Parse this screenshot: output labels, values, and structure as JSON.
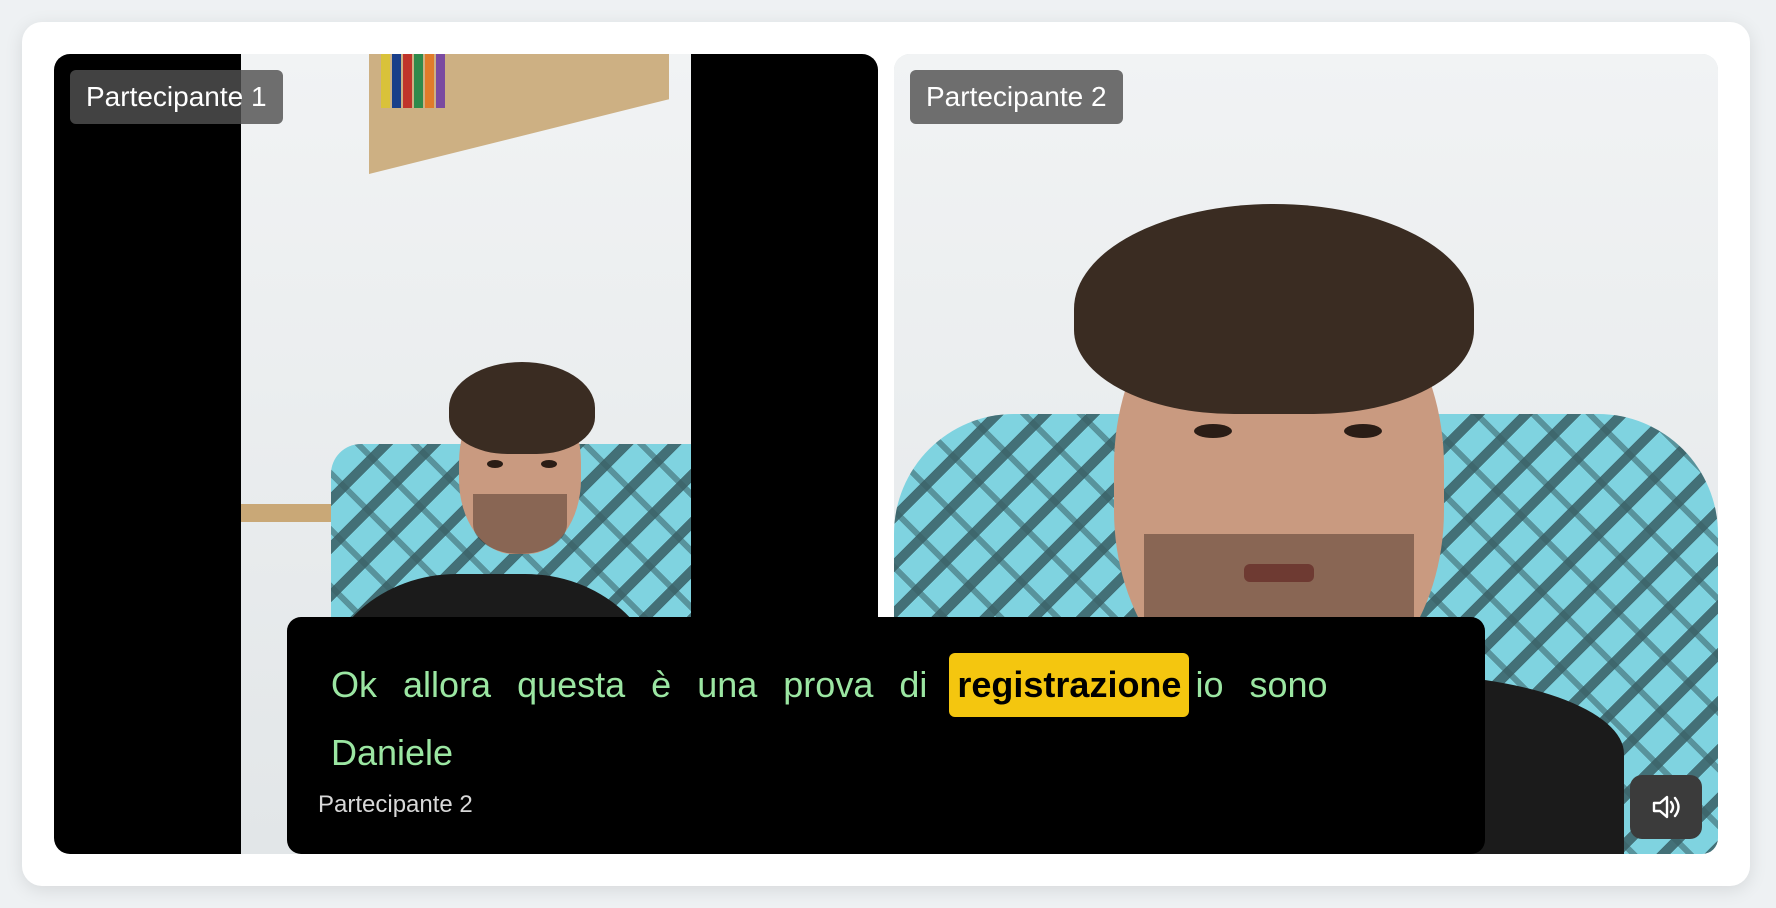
{
  "participants": [
    {
      "label": "Partecipante 1"
    },
    {
      "label": "Partecipante 2"
    }
  ],
  "caption": {
    "words": [
      "Ok",
      "allora",
      "questa",
      "è",
      "una",
      "prova",
      "di",
      "registrazione",
      "io",
      "sono",
      "Daniele"
    ],
    "highlighted_index": 7,
    "speaker": "Partecipante 2",
    "text_color": "#9be6a2",
    "highlight_color": "#f4c60f"
  },
  "controls": {
    "audio_icon": "speaker-volume-icon"
  }
}
